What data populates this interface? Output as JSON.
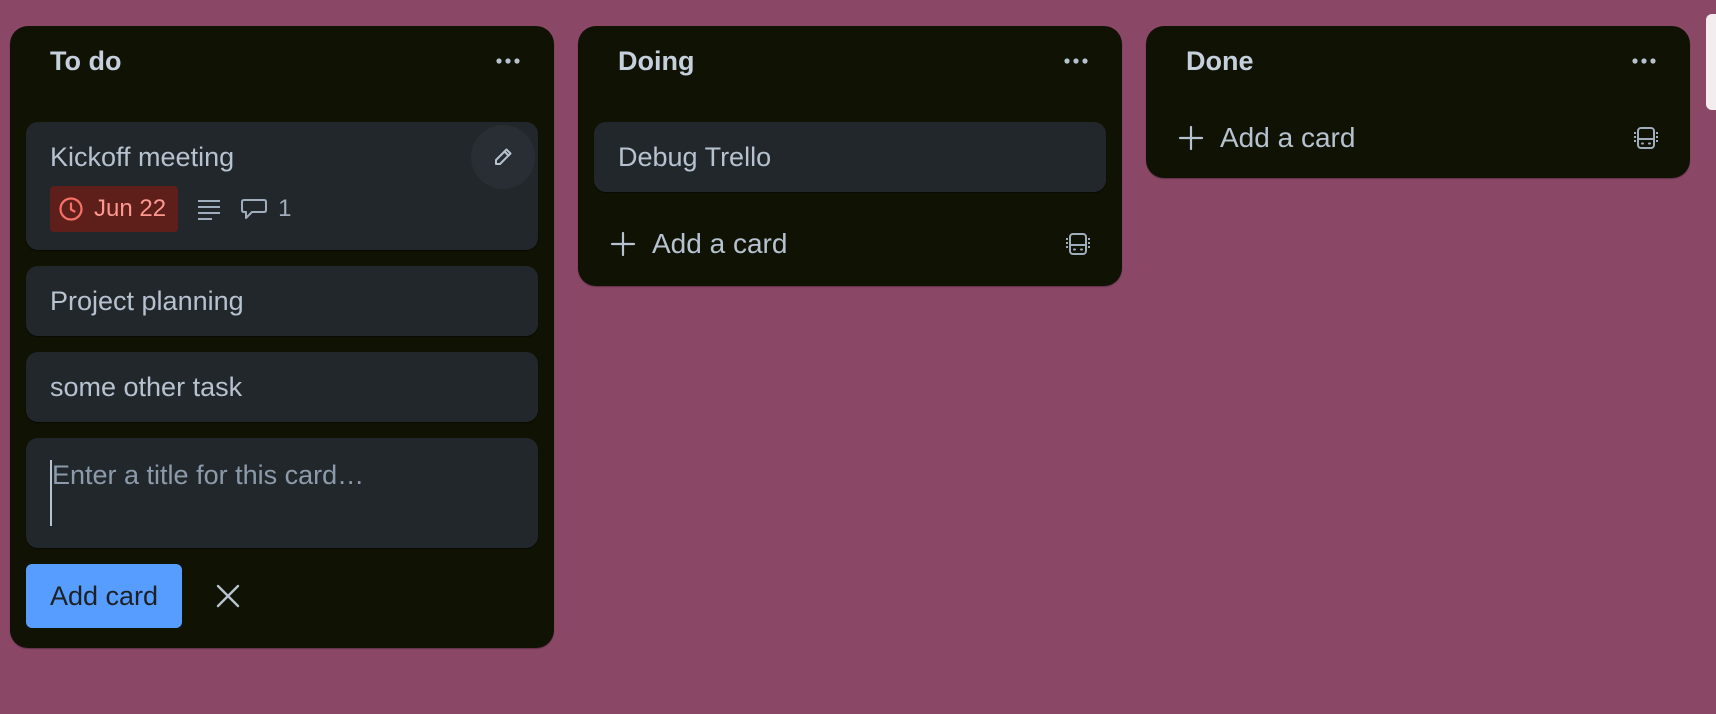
{
  "colors": {
    "board_background": "#8a4766",
    "list_background": "#101204",
    "card_background": "#22272b",
    "due_badge_background": "#5e1f1a",
    "due_badge_text": "#fd9891",
    "primary_button": "#579dff"
  },
  "lists": [
    {
      "title": "To do",
      "cards": [
        {
          "title": "Kickoff meeting",
          "due": "Jun 22",
          "has_description": true,
          "comments": "1"
        },
        {
          "title": "Project planning"
        },
        {
          "title": "some other task"
        }
      ],
      "composer": {
        "placeholder": "Enter a title for this card…",
        "value": "",
        "submit_label": "Add card"
      }
    },
    {
      "title": "Doing",
      "cards": [
        {
          "title": "Debug Trello"
        }
      ],
      "add_label": "Add a card"
    },
    {
      "title": "Done",
      "cards": [],
      "add_label": "Add a card"
    }
  ],
  "icons": {
    "list_menu": "more-horizontal-icon",
    "edit": "pencil-icon",
    "due": "clock-icon",
    "description": "description-lines-icon",
    "comment": "comment-bubble-icon",
    "add": "plus-icon",
    "template": "card-template-icon",
    "close": "close-icon"
  }
}
